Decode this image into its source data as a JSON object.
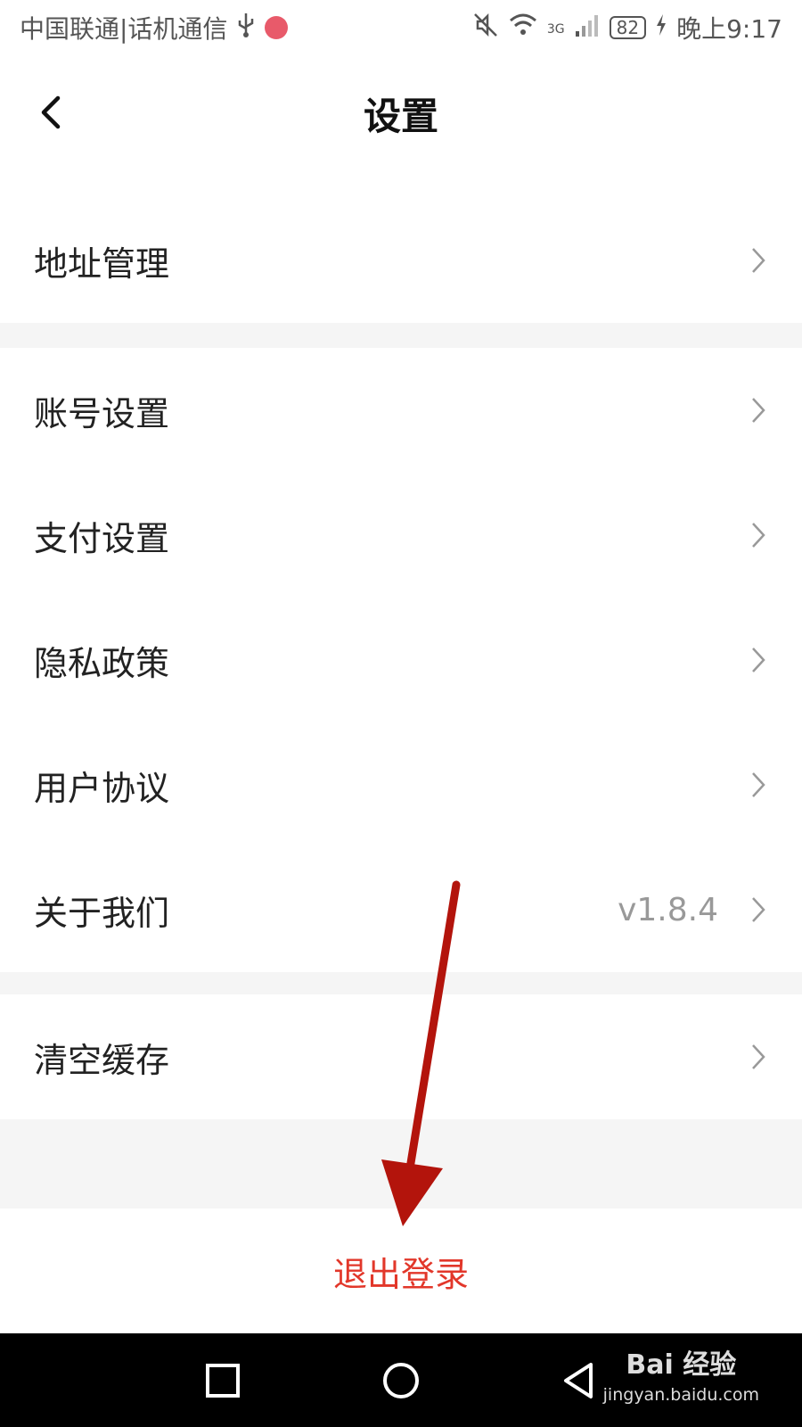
{
  "status_bar": {
    "carrier": "中国联通|话机通信",
    "network": "3G",
    "battery": "82",
    "time": "晚上9:17"
  },
  "header": {
    "title": "设置"
  },
  "settings": {
    "address": {
      "label": "地址管理"
    },
    "account": {
      "label": "账号设置"
    },
    "payment": {
      "label": "支付设置"
    },
    "privacy": {
      "label": "隐私政策"
    },
    "agreement": {
      "label": "用户协议"
    },
    "about": {
      "label": "关于我们",
      "value": "v1.8.4"
    },
    "cache": {
      "label": "清空缓存"
    }
  },
  "logout": {
    "label": "退出登录"
  },
  "watermark": {
    "main": "Bai 经验",
    "sub": "jingyan.baidu.com"
  },
  "colors": {
    "accent_red": "#e2372a",
    "annotation_arrow": "#b3140c",
    "section_gap": "#f5f5f5",
    "system_nav": "#000000"
  },
  "icons": [
    "back-chevron-icon",
    "chevron-right-icon",
    "usb-icon",
    "mute-icon",
    "wifi-icon",
    "signal-icon",
    "battery-icon",
    "charging-icon",
    "recent-apps-icon",
    "home-icon",
    "back-icon"
  ]
}
